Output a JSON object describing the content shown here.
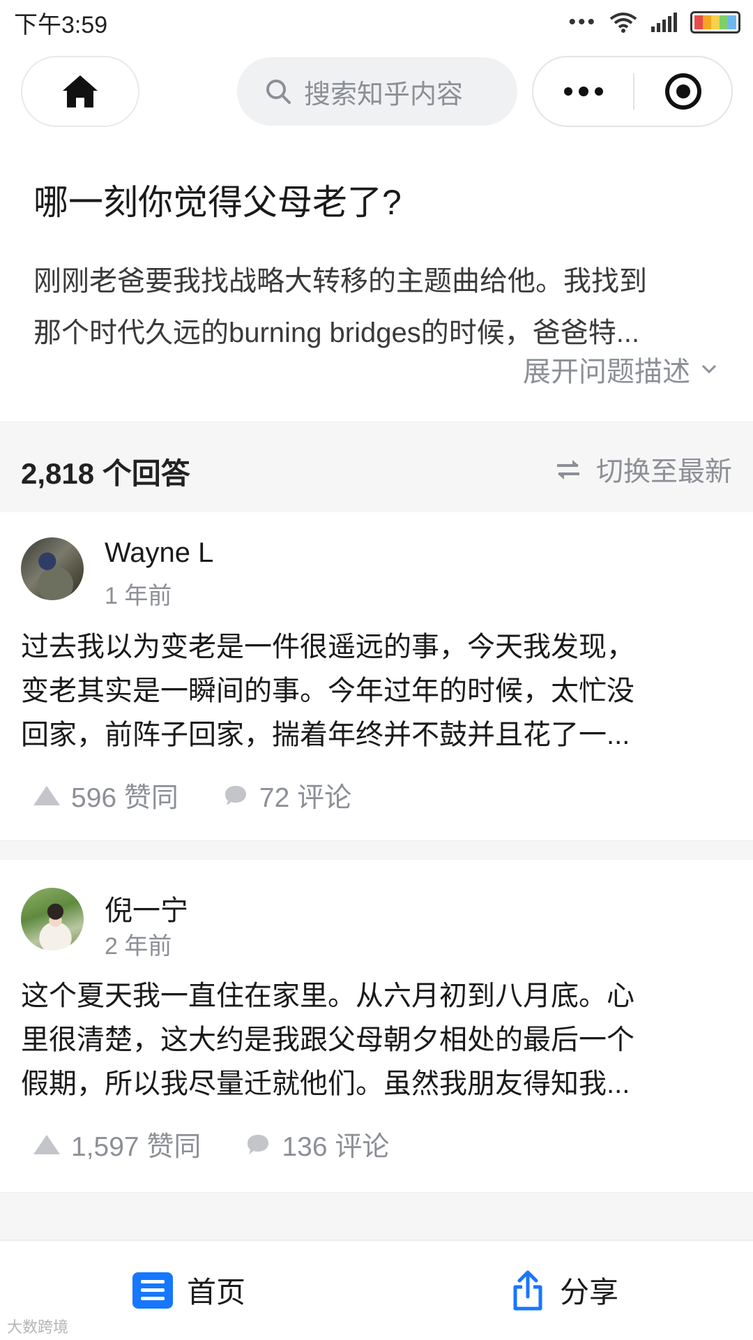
{
  "status_bar": {
    "time": "下午3:59",
    "battery_colors": [
      "#e84c4c",
      "#f5a623",
      "#f7d14c",
      "#7ecf6a",
      "#6fb7f0"
    ]
  },
  "top_nav": {
    "home_icon": "home-icon",
    "search_placeholder": "搜索知乎内容",
    "more_icon": "more-dots-icon",
    "close_icon": "target-close-icon"
  },
  "question": {
    "title": "哪一刻你觉得父母老了?",
    "description_lines": [
      "刚刚老爸要我找战略大转移的主题曲给他。我找到",
      "那个时代久远的burning bridges的时候，爸爸特..."
    ],
    "expand_label": "展开问题描述"
  },
  "answers_header": {
    "count_label": "2,818 个回答",
    "switch_label": "切换至最新"
  },
  "answers": [
    {
      "author": "Wayne L",
      "time": "1 年前",
      "excerpt_lines": [
        "过去我以为变老是一件很遥远的事，今天我发现，",
        "变老其实是一瞬间的事。今年过年的时候，太忙没",
        "回家，前阵子回家，揣着年终并不鼓并且花了一..."
      ],
      "votes": "596 赞同",
      "comments": "72 评论"
    },
    {
      "author": "倪一宁",
      "time": "2 年前",
      "excerpt_lines": [
        "这个夏天我一直住在家里。从六月初到八月底。心",
        "里很清楚，这大约是我跟父母朝夕相处的最后一个",
        "假期，所以我尽量迁就他们。虽然我朋友得知我..."
      ],
      "votes": "1,597 赞同",
      "comments": "136 评论"
    }
  ],
  "bottom_bar": {
    "home_label": "首页",
    "share_label": "分享",
    "accent": "#1677ff"
  },
  "watermark": "大数跨境"
}
